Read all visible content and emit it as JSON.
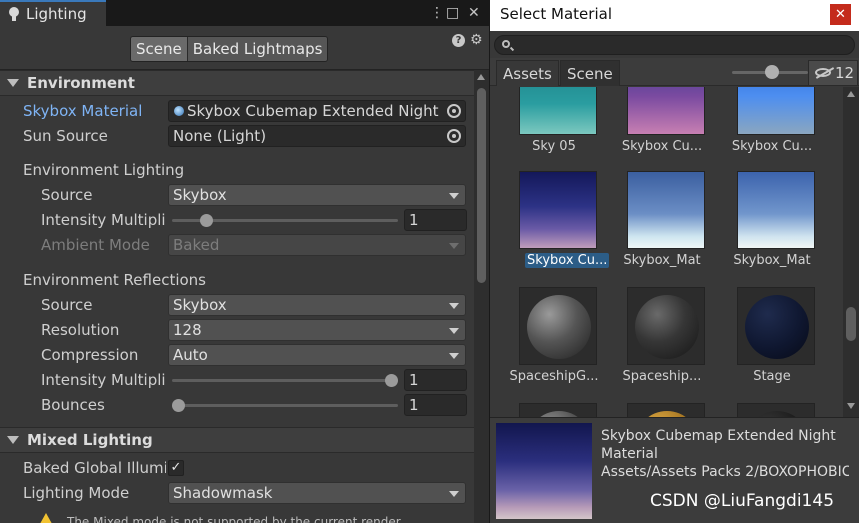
{
  "lighting": {
    "tab_title": "Lighting",
    "menu_glyph": "⋮",
    "maximize_glyph": "□",
    "close_glyph": "✕",
    "tabs": [
      "Scene",
      "Baked Lightmaps"
    ],
    "help_glyph": "?",
    "settings_glyph": "⚙",
    "environment": {
      "header": "Environment",
      "skybox_label": "Skybox Material",
      "skybox_value": "Skybox Cubemap Extended Night",
      "sun_label": "Sun Source",
      "sun_value": "None (Light)",
      "env_lighting_header": "Environment Lighting",
      "source_label": "Source",
      "source_value": "Skybox",
      "intensity_label": "Intensity Multiplier",
      "intensity_value": "1",
      "intensity_fraction": 0.13,
      "ambient_label": "Ambient Mode",
      "ambient_value": "Baked",
      "env_reflections_header": "Environment Reflections",
      "refl_source_label": "Source",
      "refl_source_value": "Skybox",
      "resolution_label": "Resolution",
      "resolution_value": "128",
      "compression_label": "Compression",
      "compression_value": "Auto",
      "refl_intensity_label": "Intensity Multiplier",
      "refl_intensity_value": "1",
      "refl_intensity_fraction": 1.0,
      "bounces_label": "Bounces",
      "bounces_value": "1",
      "bounces_fraction": 0.0
    },
    "mixed": {
      "header": "Mixed Lighting",
      "baked_gi_label": "Baked Global Illumination",
      "baked_gi_checked": "✓",
      "mode_label": "Lighting Mode",
      "mode_value": "Shadowmask",
      "warning_text": "The Mixed mode is not supported by the current render"
    }
  },
  "select_material": {
    "title": "Select Material",
    "close_glyph": "✕",
    "search_placeholder": "",
    "tabs": [
      "Assets",
      "Scene"
    ],
    "zoom_fraction": 0.53,
    "hidden_count": "12",
    "items": [
      {
        "label": "Sky 05",
        "thumb": "sky05",
        "selected": false
      },
      {
        "label": "Skybox Cu...",
        "thumb": "sky-purple",
        "selected": false
      },
      {
        "label": "Skybox Cu...",
        "thumb": "sky-blue",
        "selected": false
      },
      {
        "label": "Skybox Cu...",
        "thumb": "sky-night",
        "selected": true
      },
      {
        "label": "Skybox_Mat",
        "thumb": "sky-day",
        "selected": false
      },
      {
        "label": "Skybox_Mat",
        "thumb": "sky-day2",
        "selected": false
      },
      {
        "label": "SpaceshipG...",
        "thumb": "sphere-grey",
        "selected": false
      },
      {
        "label": "Spaceship...",
        "thumb": "sphere-dark",
        "selected": false
      },
      {
        "label": "Stage",
        "thumb": "sphere-navy",
        "selected": false
      },
      {
        "label": "",
        "thumb": "sphere-grey",
        "selected": false
      },
      {
        "label": "",
        "thumb": "sphere-gold",
        "selected": false
      },
      {
        "label": "",
        "thumb": "sphere-black",
        "selected": false
      }
    ],
    "preview": {
      "name": "Skybox Cubemap Extended Night",
      "type": "Material",
      "path": "Assets/Assets Packs 2/BOXOPHOBIC"
    }
  },
  "watermark": "CSDN @LiuFangdi145",
  "colors": {
    "accent_blue": "#7fb4f5",
    "selection": "#2c5d87",
    "close_red": "#c42b1c",
    "warning": "#f1c232"
  }
}
